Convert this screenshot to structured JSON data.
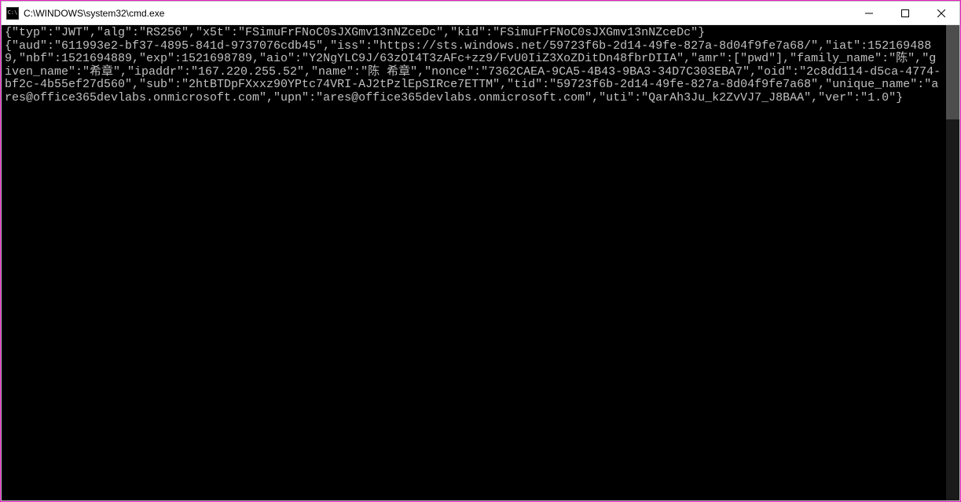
{
  "window": {
    "title": "C:\\WINDOWS\\system32\\cmd.exe"
  },
  "terminal": {
    "line1": "{\"typ\":\"JWT\",\"alg\":\"RS256\",\"x5t\":\"FSimuFrFNoC0sJXGmv13nNZceDc\",\"kid\":\"FSimuFrFNoC0sJXGmv13nNZceDc\"}",
    "line2": "{\"aud\":\"611993e2-bf37-4895-841d-9737076cdb45\",\"iss\":\"https://sts.windows.net/59723f6b-2d14-49fe-827a-8d04f9fe7a68/\",\"iat\":1521694889,\"nbf\":1521694889,\"exp\":1521698789,\"aio\":\"Y2NgYLC9J/63zOI4T3zAFc+zz9/FvU0IiZ3XoZDitDn48fbrDIIA\",\"amr\":[\"pwd\"],\"family_name\":\"陈\",\"given_name\":\"希章\",\"ipaddr\":\"167.220.255.52\",\"name\":\"陈 希章\",\"nonce\":\"7362CAEA-9CA5-4B43-9BA3-34D7C303EBA7\",\"oid\":\"2c8dd114-d5ca-4774-bf2c-4b55ef27d560\",\"sub\":\"2htBTDpFXxxz90YPtc74VRI-AJ2tPzlEpSIRce7ETTM\",\"tid\":\"59723f6b-2d14-49fe-827a-8d04f9fe7a68\",\"unique_name\":\"ares@office365devlabs.onmicrosoft.com\",\"upn\":\"ares@office365devlabs.onmicrosoft.com\",\"uti\":\"QarAh3Ju_k2ZvVJ7_J8BAA\",\"ver\":\"1.0\"}"
  }
}
